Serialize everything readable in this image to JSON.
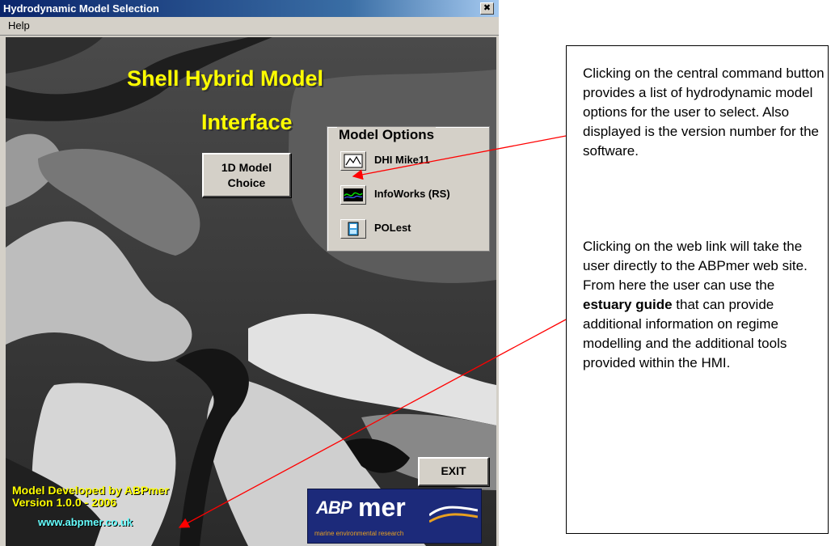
{
  "window": {
    "title": "Hydrodynamic Model Selection",
    "close_glyph": "✖",
    "menu": [
      "Help"
    ]
  },
  "app": {
    "title_line1": "Shell Hybrid Model",
    "title_line2": "Interface",
    "model_button": {
      "line1": "1D Model",
      "line2": "Choice"
    },
    "options_title": "Model Options",
    "options": [
      {
        "label": "DHI Mike11",
        "icon": "mike11-icon"
      },
      {
        "label": "InfoWorks (RS)",
        "icon": "infoworks-icon"
      },
      {
        "label": "POLest",
        "icon": "polest-icon"
      }
    ],
    "exit_label": "EXIT",
    "credit_line1": "Model Developed by ABPmer",
    "credit_line2": "Version 1.0.0 - 2006",
    "web_link": "www.abpmer.co.uk",
    "logo": {
      "abp": "ABP",
      "mer": "mer",
      "tagline": "marine environmental research"
    }
  },
  "callout": {
    "paragraph1": "Clicking on the central command button provides a list of hydrodynamic model options for the user to select. Also displayed is the version number for the software.",
    "paragraph2_before": "Clicking on the web link will take the user directly to the ABPmer web site. From here the user can use the ",
    "paragraph2_bold": "estuary guide",
    "paragraph2_after": " that can provide additional information on regime modelling and the additional tools provided within the HMI."
  },
  "colors": {
    "title_yellow": "#ffff00",
    "link_cyan": "#66ffff",
    "arrow_red": "#ff0000",
    "titlebar_blue": "#0a246a"
  }
}
